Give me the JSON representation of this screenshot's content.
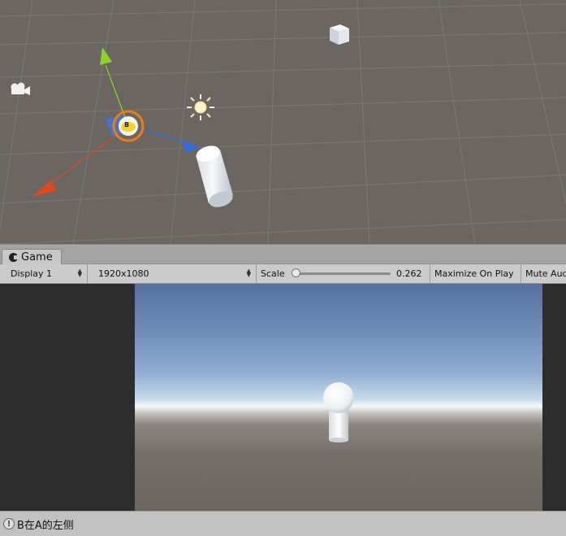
{
  "scene": {
    "selected_object_label": "B"
  },
  "game_panel": {
    "tab_label": "Game",
    "display_select": "Display 1",
    "resolution_select": "1920x1080",
    "scale_label": "Scale",
    "scale_value": "0.262",
    "scale_fraction": 0.0,
    "maximize_label": "Maximize On Play",
    "mute_label": "Mute Audio"
  },
  "status": {
    "message": "B在A的左侧"
  },
  "colors": {
    "scene_bg": "#6b6661",
    "axis_x": "#e04a1f",
    "axis_y": "#8fd12b",
    "axis_z": "#2f6de0"
  }
}
